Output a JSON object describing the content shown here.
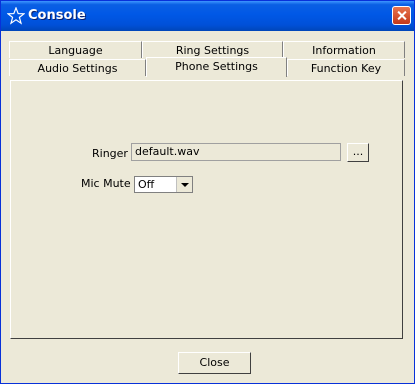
{
  "window": {
    "title": "Console",
    "close_icon": "close-x"
  },
  "tabs": {
    "row_back": [
      "Language",
      "Ring Settings",
      "Information"
    ],
    "row_front": [
      "Audio Settings",
      "Phone Settings",
      "Function Key"
    ],
    "selected": "Phone Settings"
  },
  "phone_settings": {
    "ringer_label": "Ringer",
    "ringer_value": "default.wav",
    "browse_label": "...",
    "mic_mute_label": "Mic Mute",
    "mic_mute_value": "Off"
  },
  "footer": {
    "close_label": "Close"
  },
  "colors": {
    "titlebar": "#0058e6",
    "face": "#ece9d8",
    "close_red": "#c3381a"
  }
}
